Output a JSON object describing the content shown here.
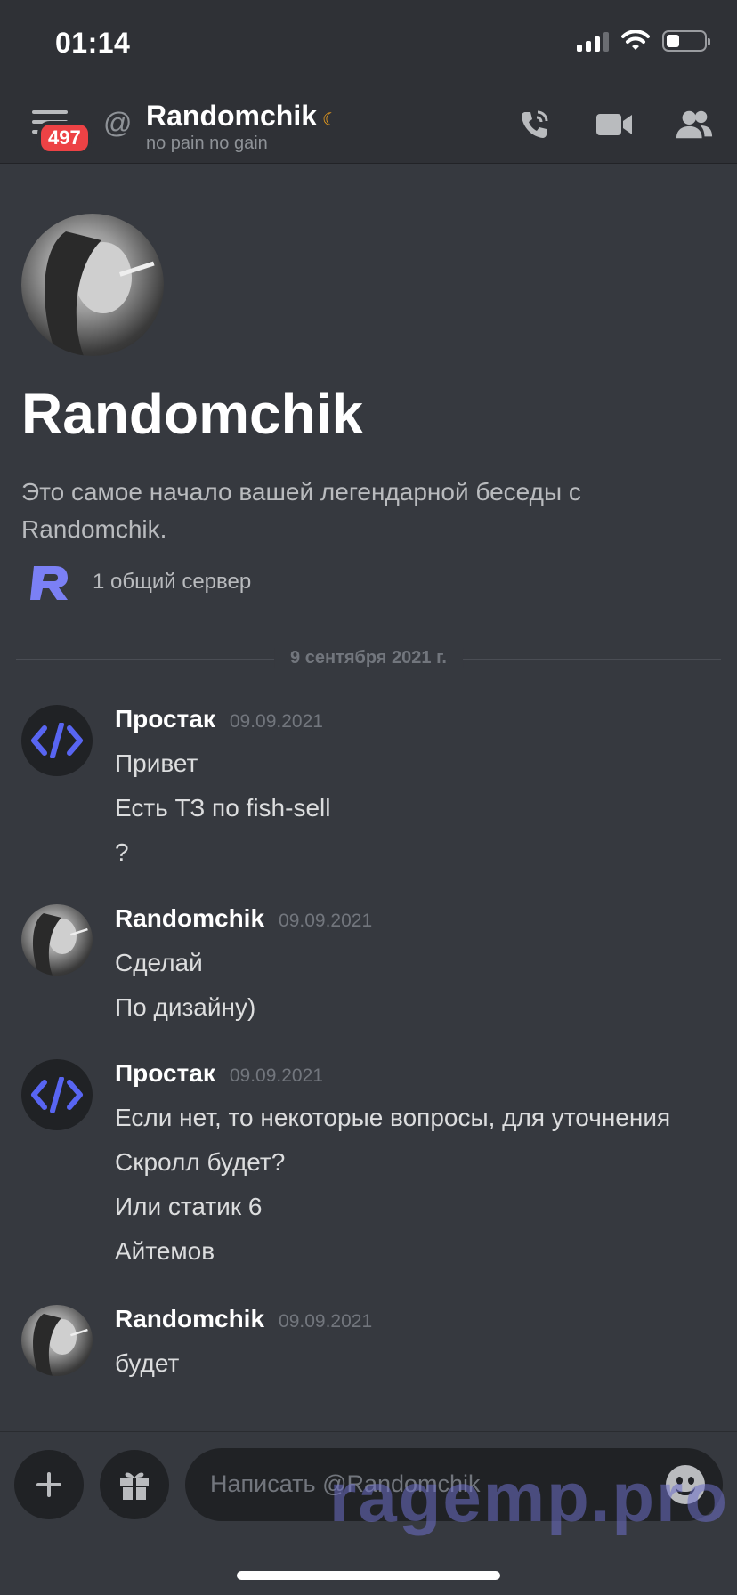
{
  "status_bar": {
    "time": "01:14"
  },
  "header": {
    "unread_badge": "497",
    "channel_name": "Randomchik",
    "channel_status": "no pain no gain"
  },
  "intro": {
    "name": "Randomchik",
    "text": "Это самое начало вашей легендарной беседы с Randomchik.",
    "mutual_servers": "1 общий сервер"
  },
  "date_divider": "9 сентября 2021 г.",
  "messages": [
    {
      "author": "Простак",
      "time": "09.09.2021",
      "lines": [
        "Привет",
        "Есть ТЗ по fish-sell",
        "?"
      ]
    },
    {
      "author": "Randomchik",
      "time": "09.09.2021",
      "lines": [
        "Сделай",
        "По дизайну)"
      ]
    },
    {
      "author": "Простак",
      "time": "09.09.2021",
      "lines": [
        "Если нет, то некоторые вопросы, для уточнения",
        "Скролл будет?",
        "Или статик 6",
        "Айтемов"
      ]
    },
    {
      "author": "Randomchik",
      "time": "09.09.2021",
      "lines": [
        "будет"
      ]
    }
  ],
  "composer": {
    "placeholder": "Написать @Randomchik"
  },
  "watermark": "ragemp.pro",
  "colors": {
    "background": "#36393f",
    "header": "#2f3136",
    "badge": "#ed4245",
    "accent": "#5865f2",
    "idle": "#faa61a"
  }
}
